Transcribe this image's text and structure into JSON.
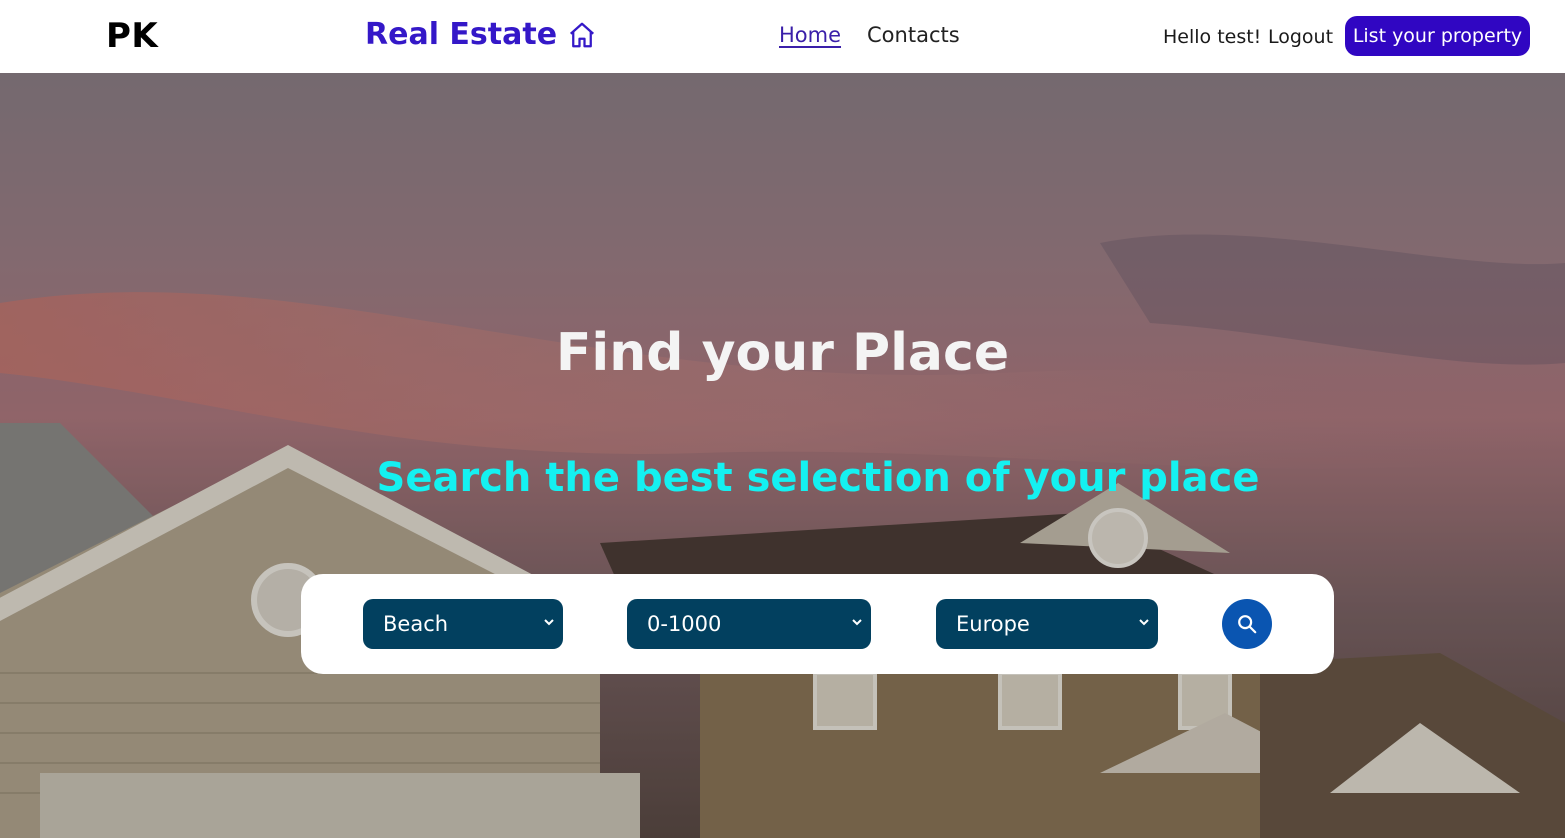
{
  "navbar": {
    "logo": "PK",
    "brand": "Real Estate",
    "brand_icon": "home-icon",
    "links": [
      {
        "label": "Home",
        "active": true
      },
      {
        "label": "Contacts",
        "active": false
      }
    ],
    "greeting": "Hello test!",
    "logout_label": "Logout",
    "cta_label": "List your property"
  },
  "hero": {
    "title": "Find your Place",
    "subtitle": "Search the best selection of your place"
  },
  "search": {
    "type": {
      "value": "Beach"
    },
    "price": {
      "value": "0-1000"
    },
    "region": {
      "value": "Europe"
    },
    "button_icon": "search-icon"
  },
  "colors": {
    "brand": "#3418c8",
    "cta": "#3006c2",
    "subtitle": "#14f1f1",
    "select_bg": "#02405f",
    "search_button": "#0a55b1"
  }
}
